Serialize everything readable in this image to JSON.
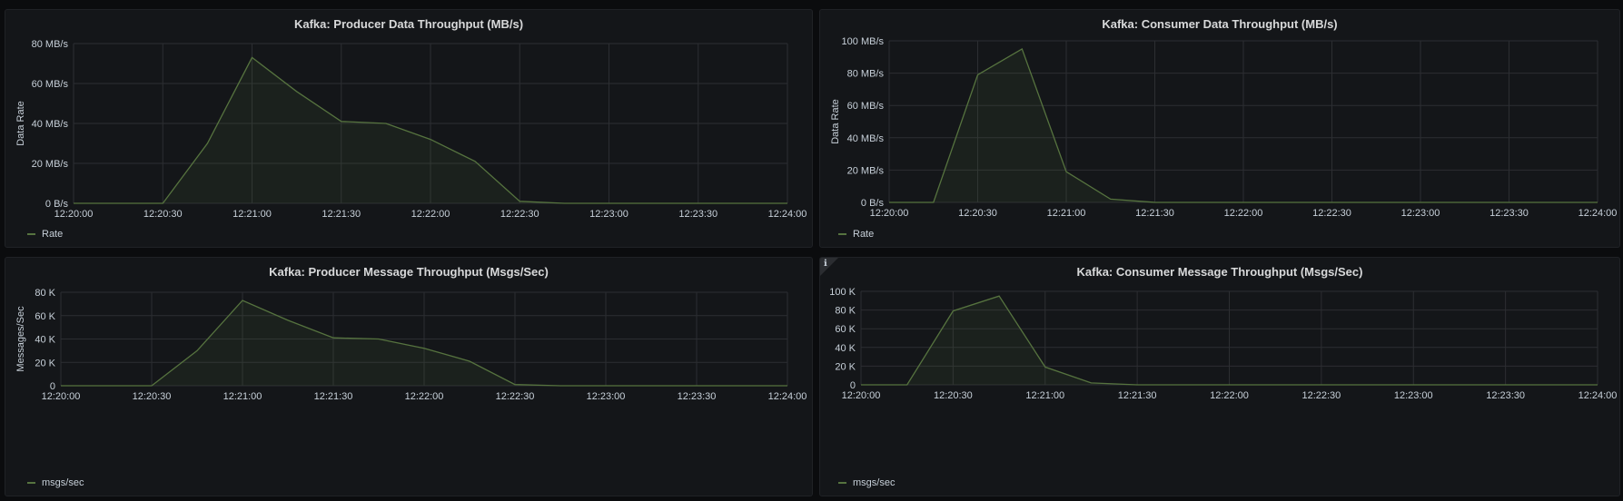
{
  "colors": {
    "series": "#56733f",
    "fill": "#56733f",
    "grid": "#2c2e32",
    "panel_bg": "#141619"
  },
  "info_icon": "info-icon",
  "chart_data": [
    {
      "type": "area",
      "title": "Kafka: Producer Data Throughput (MB/s)",
      "ylabel": "Data Rate",
      "xlabel": "",
      "ylim": [
        0,
        80
      ],
      "yticks": [
        0,
        20,
        40,
        60,
        80
      ],
      "ytick_labels": [
        "0 B/s",
        "20 MB/s",
        "40 MB/s",
        "60 MB/s",
        "80 MB/s"
      ],
      "xticks": [
        "12:20:00",
        "12:20:30",
        "12:21:00",
        "12:21:30",
        "12:22:00",
        "12:22:30",
        "12:23:00",
        "12:23:30",
        "12:24:00"
      ],
      "xlim": [
        0,
        240
      ],
      "grid": true,
      "legend": "bottom-left",
      "series": [
        {
          "name": "Rate",
          "x": [
            0,
            15,
            30,
            45,
            60,
            75,
            90,
            105,
            120,
            135,
            150,
            165,
            180,
            195,
            210,
            225,
            240
          ],
          "values": [
            0,
            0,
            0,
            30,
            73,
            56,
            41,
            40,
            32,
            21,
            1,
            0,
            0,
            0,
            0,
            0,
            0
          ]
        }
      ]
    },
    {
      "type": "area",
      "title": "Kafka: Consumer Data Throughput (MB/s)",
      "ylabel": "Data Rate",
      "xlabel": "",
      "ylim": [
        0,
        100
      ],
      "yticks": [
        0,
        20,
        40,
        60,
        80,
        100
      ],
      "ytick_labels": [
        "0 B/s",
        "20 MB/s",
        "40 MB/s",
        "60 MB/s",
        "80 MB/s",
        "100 MB/s"
      ],
      "xticks": [
        "12:20:00",
        "12:20:30",
        "12:21:00",
        "12:21:30",
        "12:22:00",
        "12:22:30",
        "12:23:00",
        "12:23:30",
        "12:24:00"
      ],
      "xlim": [
        0,
        240
      ],
      "grid": true,
      "legend": "bottom-left",
      "series": [
        {
          "name": "Rate",
          "x": [
            0,
            15,
            30,
            45,
            60,
            75,
            90,
            105,
            120,
            135,
            150,
            165,
            180,
            195,
            210,
            225,
            240
          ],
          "values": [
            0,
            0,
            79,
            95,
            19,
            2,
            0,
            0,
            0,
            0,
            0,
            0,
            0,
            0,
            0,
            0,
            0
          ]
        }
      ]
    },
    {
      "type": "area",
      "title": "Kafka: Producer Message Throughput (Msgs/Sec)",
      "ylabel": "Messages/Sec",
      "xlabel": "",
      "ylim": [
        0,
        80000
      ],
      "yticks": [
        0,
        20000,
        40000,
        60000,
        80000
      ],
      "ytick_labels": [
        "0",
        "20 K",
        "40 K",
        "60 K",
        "80 K"
      ],
      "xticks": [
        "12:20:00",
        "12:20:30",
        "12:21:00",
        "12:21:30",
        "12:22:00",
        "12:22:30",
        "12:23:00",
        "12:23:30",
        "12:24:00"
      ],
      "xlim": [
        0,
        240
      ],
      "grid": true,
      "legend": "bottom-left",
      "series": [
        {
          "name": "msgs/sec",
          "x": [
            0,
            15,
            30,
            45,
            60,
            75,
            90,
            105,
            120,
            135,
            150,
            165,
            180,
            195,
            210,
            225,
            240
          ],
          "values": [
            0,
            0,
            0,
            30000,
            73000,
            56000,
            41000,
            40000,
            32000,
            21000,
            1000,
            0,
            0,
            0,
            0,
            0,
            0
          ]
        }
      ]
    },
    {
      "type": "area",
      "title": "Kafka: Consumer Message Throughput (Msgs/Sec)",
      "ylabel": "",
      "xlabel": "",
      "ylim": [
        0,
        100000
      ],
      "yticks": [
        0,
        20000,
        40000,
        60000,
        80000,
        100000
      ],
      "ytick_labels": [
        "0",
        "20 K",
        "40 K",
        "60 K",
        "80 K",
        "100 K"
      ],
      "xticks": [
        "12:20:00",
        "12:20:30",
        "12:21:00",
        "12:21:30",
        "12:22:00",
        "12:22:30",
        "12:23:00",
        "12:23:30",
        "12:24:00"
      ],
      "xlim": [
        0,
        240
      ],
      "grid": true,
      "legend": "bottom-left",
      "series": [
        {
          "name": "msgs/sec",
          "x": [
            0,
            15,
            30,
            45,
            60,
            75,
            90,
            105,
            120,
            135,
            150,
            165,
            180,
            195,
            210,
            225,
            240
          ],
          "values": [
            0,
            0,
            79000,
            95000,
            19000,
            2000,
            0,
            0,
            0,
            0,
            0,
            0,
            0,
            0,
            0,
            0,
            0
          ]
        }
      ]
    }
  ]
}
